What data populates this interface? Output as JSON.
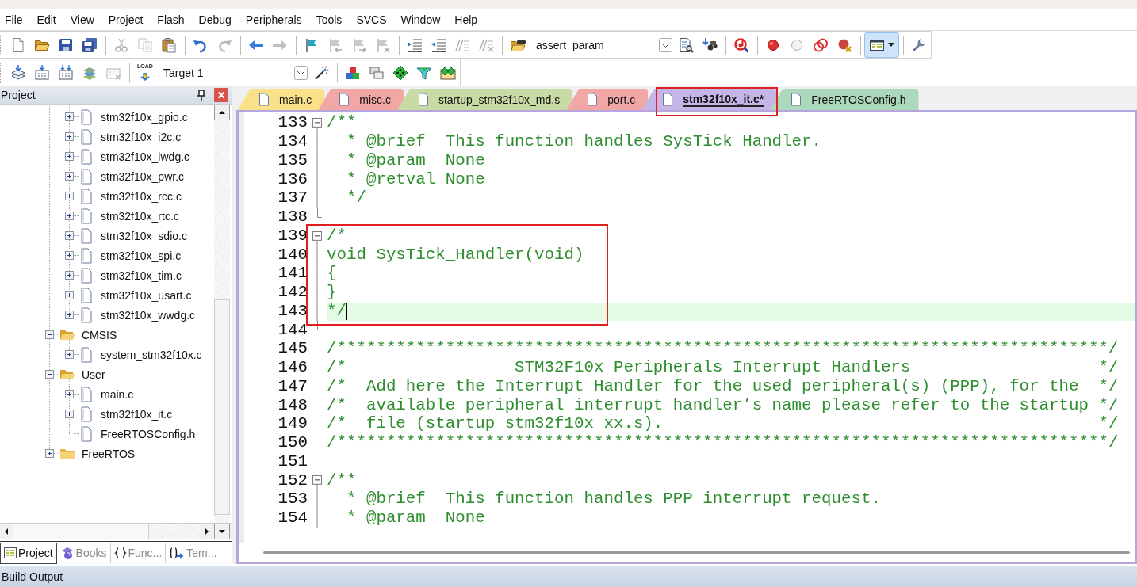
{
  "menu": [
    "File",
    "Edit",
    "View",
    "Project",
    "Flash",
    "Debug",
    "Peripherals",
    "Tools",
    "SVCS",
    "Window",
    "Help"
  ],
  "toolbar_1": {
    "items": [
      {
        "kind": "button",
        "disabled": false
      },
      {
        "kind": "button",
        "disabled": false
      },
      {
        "kind": "button",
        "disabled": false
      },
      {
        "kind": "button",
        "disabled": false
      },
      {
        "kind": "separator"
      },
      {
        "kind": "button",
        "disabled": true
      },
      {
        "kind": "button",
        "disabled": true
      },
      {
        "kind": "button",
        "disabled": false
      },
      {
        "kind": "separator"
      },
      {
        "kind": "button",
        "disabled": false
      },
      {
        "kind": "button",
        "disabled": true
      },
      {
        "kind": "separator"
      },
      {
        "kind": "button",
        "disabled": false
      },
      {
        "kind": "button",
        "disabled": true
      },
      {
        "kind": "separator"
      },
      {
        "kind": "button",
        "disabled": false
      },
      {
        "kind": "button",
        "disabled": true
      },
      {
        "kind": "button",
        "disabled": true
      },
      {
        "kind": "button",
        "disabled": true
      },
      {
        "kind": "separator"
      },
      {
        "kind": "button",
        "disabled": false
      },
      {
        "kind": "button",
        "disabled": false
      },
      {
        "kind": "button",
        "disabled": true
      },
      {
        "kind": "button",
        "disabled": true
      },
      {
        "kind": "separator"
      },
      {
        "kind": "button",
        "disabled": false
      },
      {
        "kind": "combo",
        "value": "assert_param"
      },
      {
        "kind": "button",
        "disabled": false
      },
      {
        "kind": "button",
        "disabled": false
      },
      {
        "kind": "separator"
      },
      {
        "kind": "button",
        "disabled": false
      },
      {
        "kind": "separator"
      },
      {
        "kind": "button",
        "disabled": false
      },
      {
        "kind": "button",
        "disabled": false
      },
      {
        "kind": "button",
        "disabled": false
      },
      {
        "kind": "button",
        "disabled": false
      },
      {
        "kind": "separator"
      },
      {
        "kind": "menu_button",
        "on": true
      },
      {
        "kind": "separator"
      },
      {
        "kind": "button",
        "disabled": false
      }
    ]
  },
  "toolbar_2": {
    "items": [
      {
        "kind": "button",
        "disabled": false
      },
      {
        "kind": "button",
        "disabled": false
      },
      {
        "kind": "button",
        "disabled": false
      },
      {
        "kind": "button",
        "disabled": false
      },
      {
        "kind": "button",
        "disabled": true
      },
      {
        "kind": "separator"
      },
      {
        "kind": "button",
        "disabled": false,
        "label": "LOAD"
      },
      {
        "kind": "combo",
        "value": "Target 1"
      },
      {
        "kind": "button",
        "disabled": false
      },
      {
        "kind": "separator"
      },
      {
        "kind": "button",
        "disabled": false
      },
      {
        "kind": "button",
        "disabled": false
      },
      {
        "kind": "button",
        "disabled": false
      },
      {
        "kind": "button",
        "disabled": false
      },
      {
        "kind": "button",
        "disabled": false
      }
    ]
  },
  "project_panel": {
    "title": "Project",
    "tree": [
      {
        "children": [
          {
            "label": "stm32f10x_gpio.c",
            "kind": "file",
            "expanded": false
          },
          {
            "label": "stm32f10x_i2c.c",
            "kind": "file",
            "expanded": false
          },
          {
            "label": "stm32f10x_iwdg.c",
            "kind": "file",
            "expanded": false
          },
          {
            "label": "stm32f10x_pwr.c",
            "kind": "file",
            "expanded": false
          },
          {
            "label": "stm32f10x_rcc.c",
            "kind": "file",
            "expanded": false
          },
          {
            "label": "stm32f10x_rtc.c",
            "kind": "file",
            "expanded": false
          },
          {
            "label": "stm32f10x_sdio.c",
            "kind": "file",
            "expanded": false
          },
          {
            "label": "stm32f10x_spi.c",
            "kind": "file",
            "expanded": false
          },
          {
            "label": "stm32f10x_tim.c",
            "kind": "file",
            "expanded": false
          },
          {
            "label": "stm32f10x_usart.c",
            "kind": "file",
            "expanded": false
          },
          {
            "label": "stm32f10x_wwdg.c",
            "kind": "file",
            "expanded": false
          }
        ]
      },
      {
        "label": "CMSIS",
        "kind": "folder",
        "expanded": true,
        "children": [
          {
            "label": "system_stm32f10x.c",
            "kind": "file",
            "expanded": false
          }
        ]
      },
      {
        "label": "User",
        "kind": "folder",
        "expanded": true,
        "children": [
          {
            "label": "main.c",
            "kind": "file",
            "expanded": false
          },
          {
            "label": "stm32f10x_it.c",
            "kind": "file",
            "expanded": false
          },
          {
            "label": "FreeRTOSConfig.h",
            "kind": "file"
          }
        ]
      },
      {
        "label": "FreeRTOS",
        "kind": "folder",
        "expanded": false
      }
    ],
    "tabs": [
      {
        "label": "Project",
        "selected": true
      },
      {
        "label": "Books",
        "selected": false
      },
      {
        "label": "Func...",
        "selected": false
      },
      {
        "label": "Tem...",
        "selected": false
      }
    ]
  },
  "editor": {
    "tabs": [
      {
        "label": "main.c",
        "color": "#fbe08a",
        "selected": false,
        "marked": false
      },
      {
        "label": "misc.c",
        "color": "#f2a7a7",
        "selected": false,
        "marked": false
      },
      {
        "label": "startup_stm32f10x_md.s",
        "color": "#c9dba5",
        "selected": false,
        "marked": false
      },
      {
        "label": "port.c",
        "color": "#f2a7a7",
        "selected": false,
        "marked": false
      },
      {
        "label": "stm32f10x_it.c*",
        "color": "#c6b6e8",
        "selected": true,
        "marked": true
      },
      {
        "label": "FreeRTOSConfig.h",
        "color": "#acd9bb",
        "selected": false,
        "marked": false
      }
    ],
    "lines": [
      {
        "number": "133",
        "code": "/**",
        "kind": "fold_start",
        "current": false,
        "marked": false
      },
      {
        "number": "134",
        "code": "  * @brief  This function handles SysTick Handler.",
        "kind": "fold_body",
        "current": false,
        "marked": false
      },
      {
        "number": "135",
        "code": "  * @param  None",
        "kind": "fold_body",
        "current": false,
        "marked": false
      },
      {
        "number": "136",
        "code": "  * @retval None",
        "kind": "fold_body",
        "current": false,
        "marked": false
      },
      {
        "number": "137",
        "code": "  */",
        "kind": "fold_body",
        "current": false,
        "marked": false
      },
      {
        "number": "138",
        "kind": "fold_end",
        "current": false,
        "marked": false
      },
      {
        "number": "139",
        "code": "/*",
        "kind": "fold_start",
        "current": false,
        "marked": true
      },
      {
        "number": "140",
        "code": "void SysTick_Handler(void)",
        "kind": "fold_body",
        "current": false,
        "marked": true
      },
      {
        "number": "141",
        "code": "{",
        "kind": "fold_body",
        "current": false,
        "marked": true
      },
      {
        "number": "142",
        "code": "}",
        "kind": "fold_body",
        "current": false,
        "marked": true
      },
      {
        "number": "143",
        "code": "*/",
        "kind": "fold_body",
        "current": true,
        "marked": true
      },
      {
        "number": "144",
        "kind": "fold_end",
        "current": false,
        "marked": false
      },
      {
        "number": "145",
        "code": "/******************************************************************************/",
        "current": false,
        "marked": false
      },
      {
        "number": "146",
        "code": "/*                 STM32F10x Peripherals Interrupt Handlers                   */",
        "current": false,
        "marked": false
      },
      {
        "number": "147",
        "code": "/*  Add here the Interrupt Handler for the used peripheral(s) (PPP), for the  */",
        "current": false,
        "marked": false
      },
      {
        "number": "148",
        "code": "/*  available peripheral interrupt handler’s name please refer to the startup */",
        "current": false,
        "marked": false
      },
      {
        "number": "149",
        "code": "/*  file (startup_stm32f10x_xx.s).                                            */",
        "current": false,
        "marked": false
      },
      {
        "number": "150",
        "code": "/******************************************************************************/",
        "current": false,
        "marked": false
      },
      {
        "number": "151",
        "current": false,
        "marked": false
      },
      {
        "number": "152",
        "code": "/**",
        "kind": "fold_start",
        "current": false,
        "marked": false
      },
      {
        "number": "153",
        "code": "  * @brief  This function handles PPP interrupt request.",
        "kind": "fold_body",
        "current": false,
        "marked": false
      },
      {
        "number": "154",
        "code": "  * @param  None",
        "kind": "fold_body",
        "current": false,
        "marked": false
      }
    ]
  },
  "build_output": {
    "title": "Build Output"
  }
}
